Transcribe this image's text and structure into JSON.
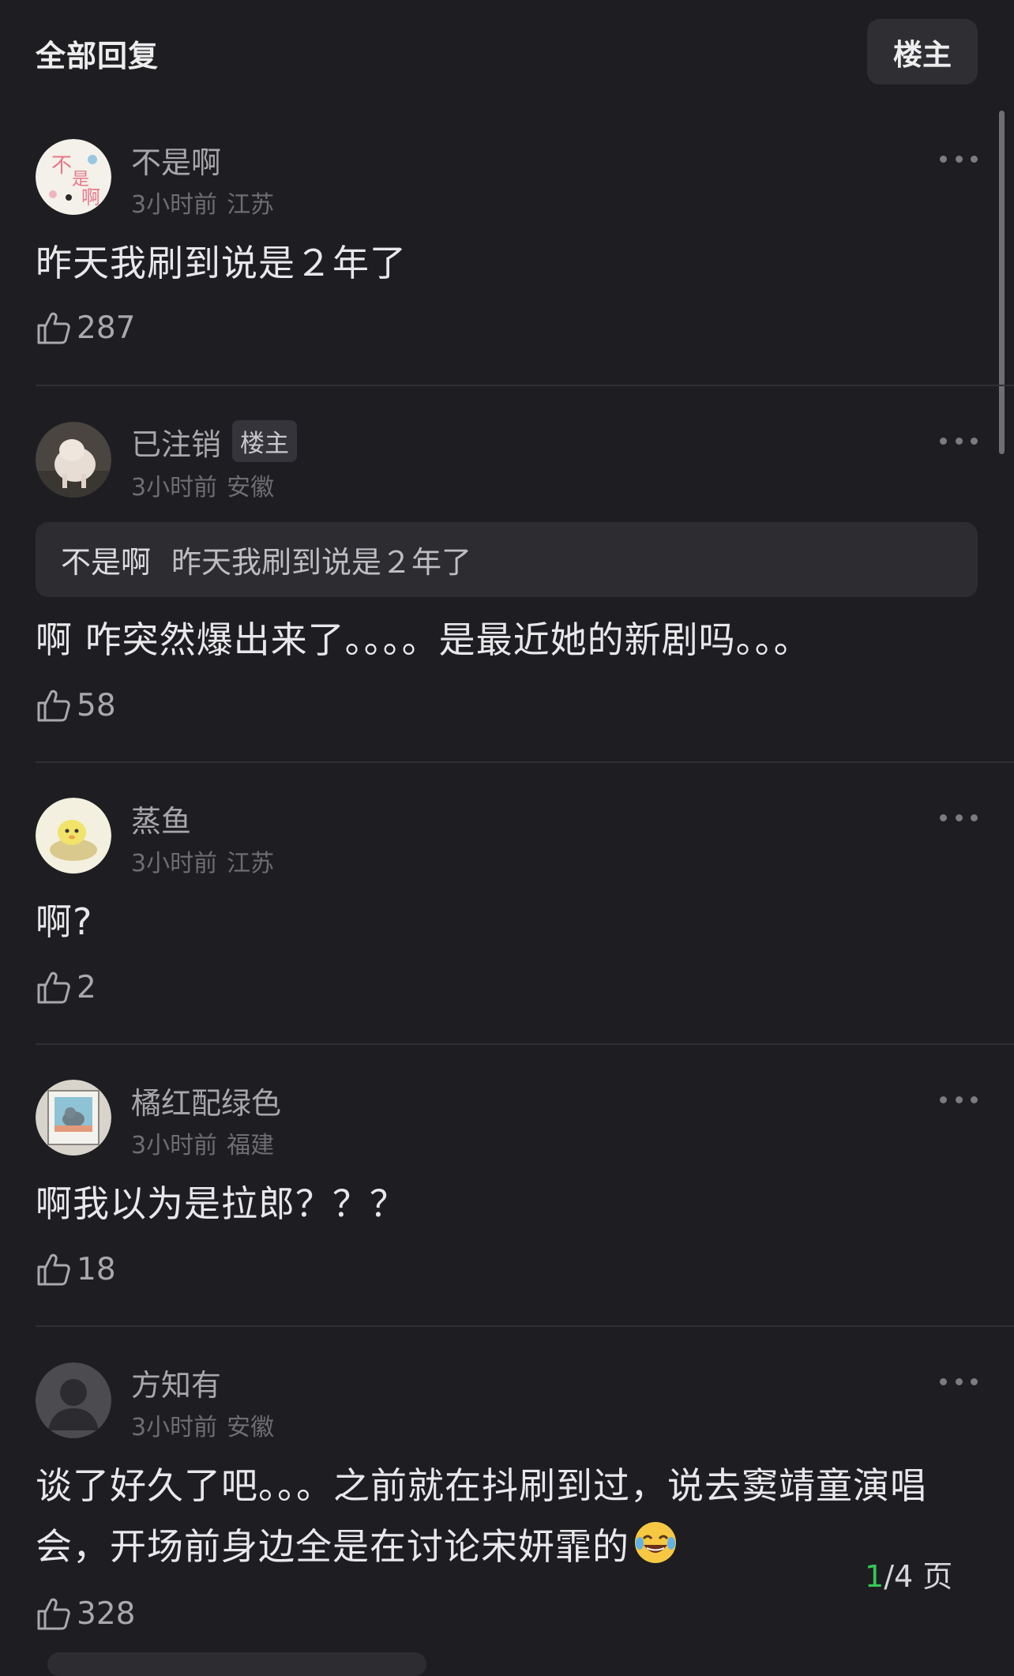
{
  "header": {
    "title": "全部回复",
    "filter_label": "楼主"
  },
  "comments": [
    {
      "username": "不是啊",
      "time": "3小时前",
      "location": "江苏",
      "text": "昨天我刷到说是２年了",
      "likes": "287"
    },
    {
      "username": "已注销",
      "badge": "楼主",
      "time": "3小时前",
      "location": "安徽",
      "quote_user": "不是啊",
      "quote_text": "昨天我刷到说是２年了",
      "text": "啊  咋突然爆出来了。。。。是最近她的新剧吗。。。",
      "likes": "58"
    },
    {
      "username": "蒸鱼",
      "time": "3小时前",
      "location": "江苏",
      "text": "啊?",
      "likes": "2"
    },
    {
      "username": "橘红配绿色",
      "time": "3小时前",
      "location": "福建",
      "text": "啊我以为是拉郎？？？",
      "likes": "18"
    },
    {
      "username": "方知有",
      "time": "3小时前",
      "location": "安徽",
      "text_line1": "谈了好久了吧。。。之前就在抖刷到过，说去窦靖童演唱",
      "text_line2": "会，开场前身边全是在讨论宋妍霏的",
      "likes": "328"
    }
  ],
  "pager": {
    "current": "1",
    "total": "/4 页"
  },
  "icons": {
    "like": "thumbs-up-icon",
    "more": "more-dots-icon",
    "emoji": "tears-of-joy-emoji"
  },
  "colors": {
    "background": "#1e1e22",
    "pager_current": "#34c759"
  }
}
